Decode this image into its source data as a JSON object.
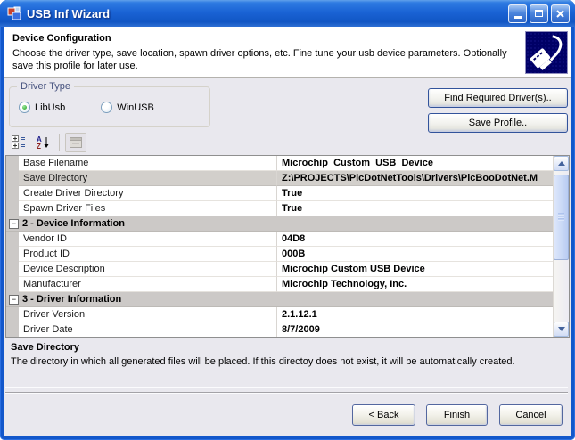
{
  "window": {
    "title": "USB Inf Wizard"
  },
  "header": {
    "title": "Device Configuration",
    "description": "Choose the driver type, save location, spawn driver options, etc. Fine tune your usb device parameters.  Optionally save this profile for later use."
  },
  "driver_type": {
    "label": "Driver Type",
    "options": [
      {
        "label": "LibUsb",
        "selected": true
      },
      {
        "label": "WinUSB",
        "selected": false
      }
    ]
  },
  "actions": {
    "find_drivers": "Find Required Driver(s)..",
    "save_profile": "Save Profile.."
  },
  "toolbar": {
    "sort_a": "A",
    "sort_z": "Z"
  },
  "property_grid": {
    "rows": [
      {
        "type": "item",
        "label": "Base Filename",
        "value": "Microchip_Custom_USB_Device",
        "selected": false
      },
      {
        "type": "item",
        "label": "Save Directory",
        "value": "Z:\\PROJECTS\\PicDotNetTools\\Drivers\\PicBooDotNet.M",
        "selected": true
      },
      {
        "type": "item",
        "label": "Create Driver Directory",
        "value": "True",
        "selected": false
      },
      {
        "type": "item",
        "label": "Spawn Driver Files",
        "value": "True",
        "selected": false
      },
      {
        "type": "category",
        "label": "2 - Device Information"
      },
      {
        "type": "item",
        "label": "Vendor ID",
        "value": "04D8",
        "selected": false
      },
      {
        "type": "item",
        "label": "Product ID",
        "value": "000B",
        "selected": false
      },
      {
        "type": "item",
        "label": "Device Description",
        "value": "Microchip Custom USB Device",
        "selected": false
      },
      {
        "type": "item",
        "label": "Manufacturer",
        "value": "Microchip Technology, Inc.",
        "selected": false
      },
      {
        "type": "category",
        "label": "3 - Driver Information"
      },
      {
        "type": "item",
        "label": "Driver Version",
        "value": "2.1.12.1",
        "selected": false
      },
      {
        "type": "item",
        "label": "Driver Date",
        "value": "8/7/2009",
        "selected": false
      }
    ]
  },
  "help_panel": {
    "title": "Save Directory",
    "description": "The directory in which all generated files will be placed.  If this directoy does not exist, it will be automatically created."
  },
  "wizard_buttons": {
    "back": "< Back",
    "finish": "Finish",
    "cancel": "Cancel"
  },
  "colors": {
    "titlebar_blue": "#1a63d5",
    "body_background": "#e9e8ee",
    "category_gray": "#ccc9c7",
    "selected_row_gray": "#d2cfcb",
    "icon_navy": "#000066",
    "groupbox_label_blue": "#46527e"
  }
}
